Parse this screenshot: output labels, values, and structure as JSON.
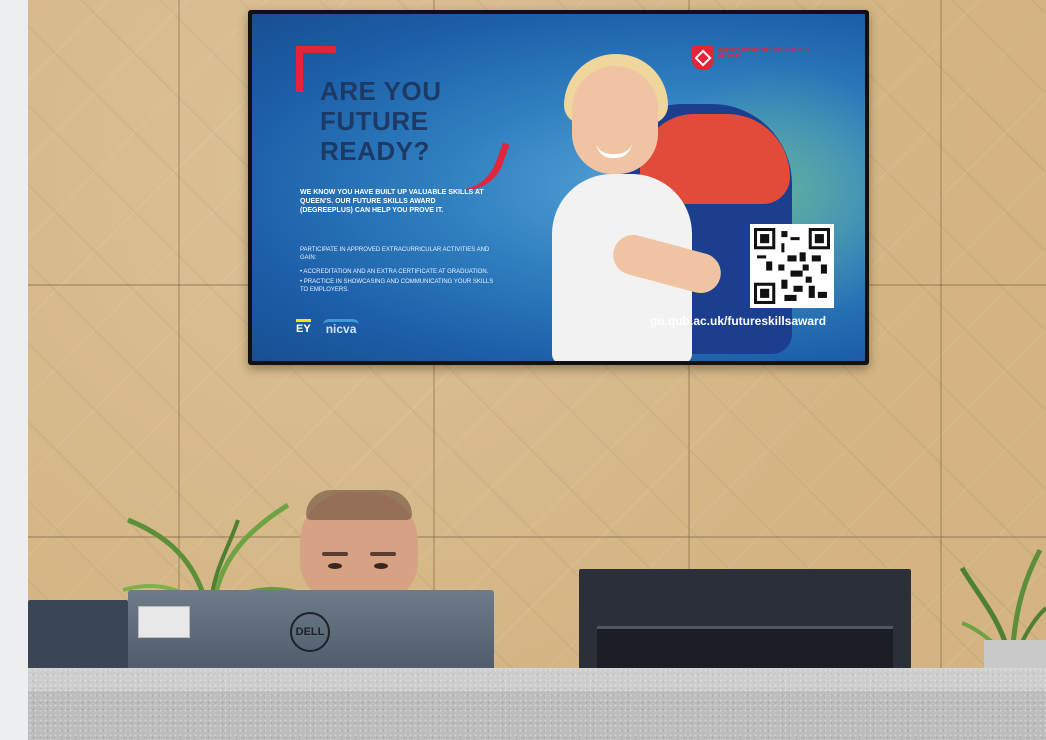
{
  "tv": {
    "headline": [
      "ARE YOU",
      "FUTURE",
      "READY?"
    ],
    "body": "WE KNOW YOU HAVE BUILT UP VALUABLE SKILLS AT QUEEN'S. OUR FUTURE SKILLS AWARD (DEGREEPLUS) CAN HELP YOU PROVE IT.",
    "sub": "PARTICIPATE IN APPROVED EXTRACURRICULAR ACTIVITIES AND GAIN:",
    "bullets": [
      "• ACCREDITATION AND AN EXTRA CERTIFICATE AT GRADUATION.",
      "• PRACTICE IN SHOWCASING AND COMMUNICATING YOUR SKILLS TO EMPLOYERS."
    ],
    "url": "go.qub.ac.uk/futureskillsaward",
    "logo_ey": "EY",
    "logo_nicva": "nicva",
    "qub_text": "QUEEN'S UNIVERSITY BELFAST",
    "qub_text2": "DEGREE PLUS"
  },
  "monitor": {
    "brand": "DELL"
  },
  "colors": {
    "accent_red": "#e2253a",
    "navy": "#1d3a66",
    "wall": "#d6b887"
  }
}
